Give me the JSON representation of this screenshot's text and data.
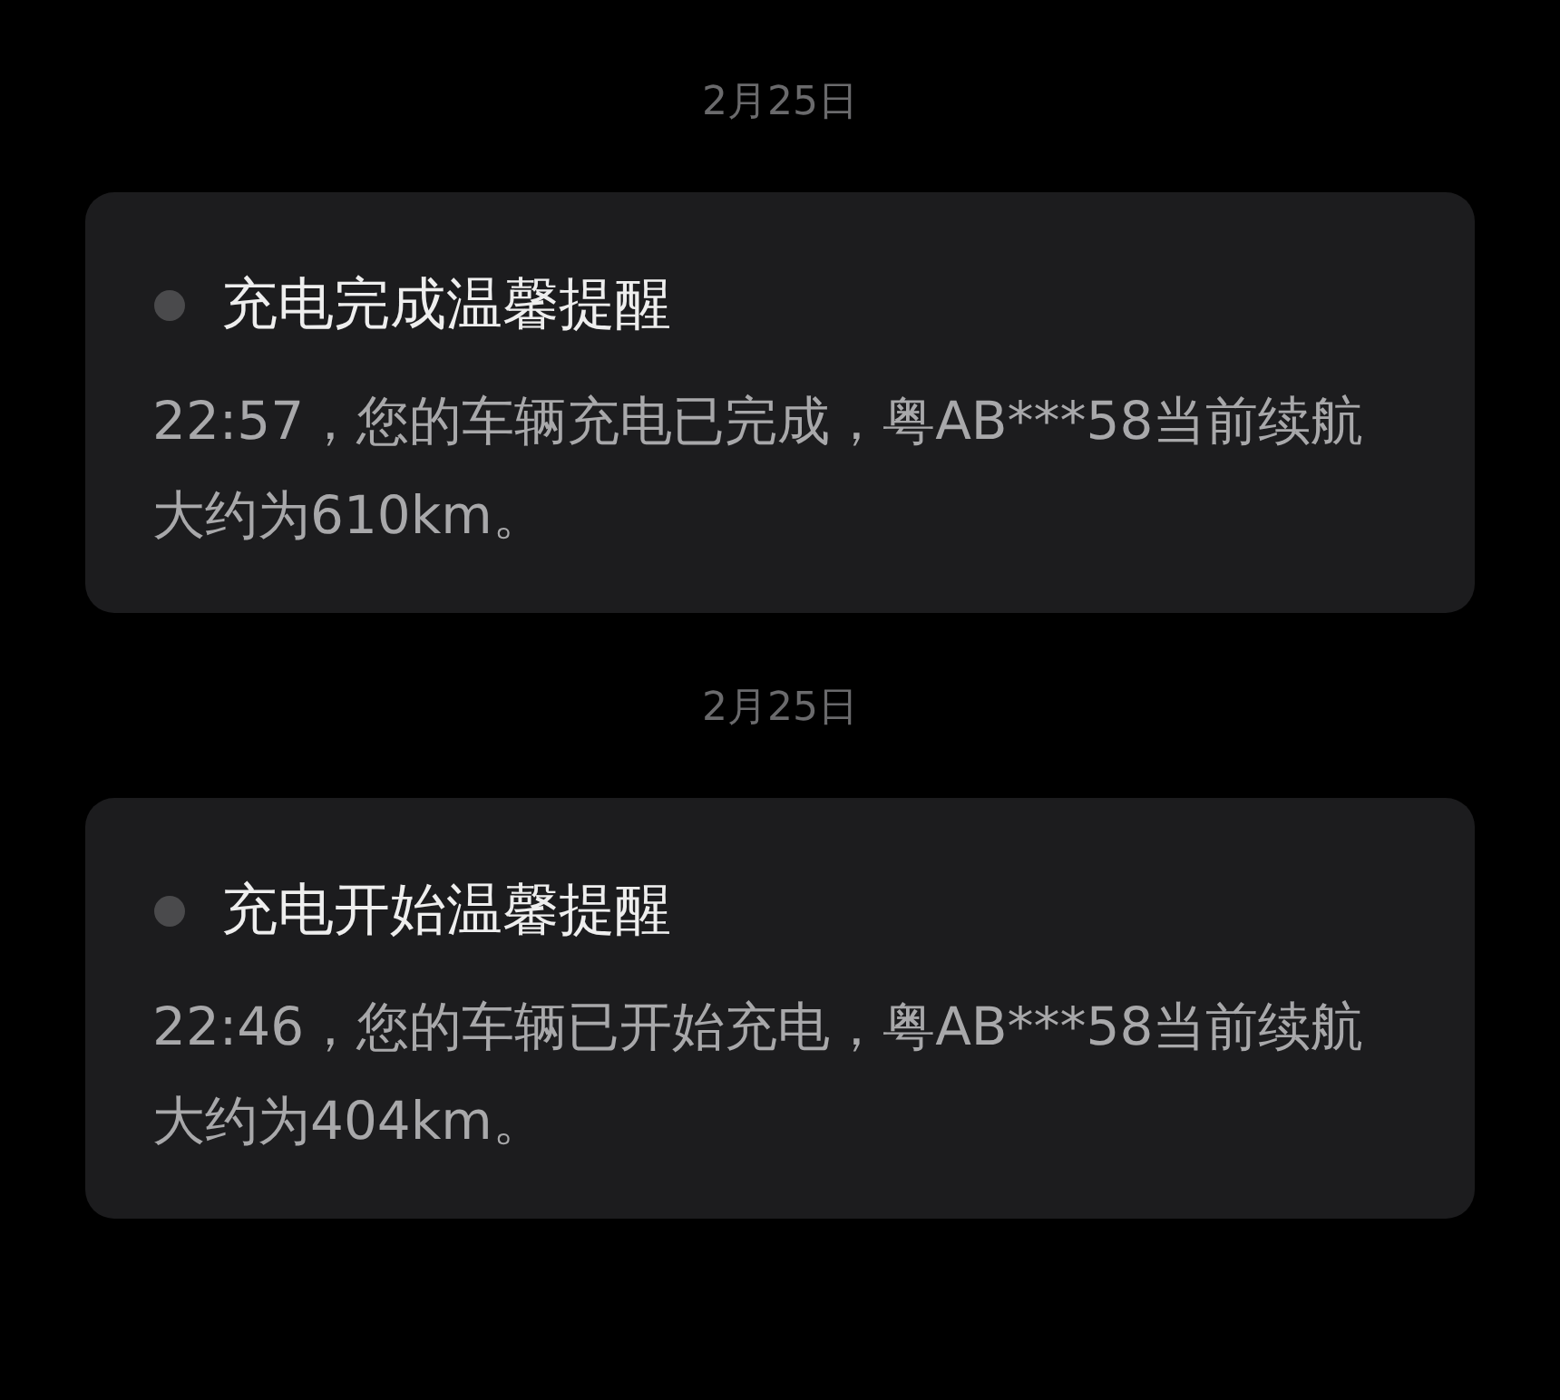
{
  "messages": [
    {
      "date": "2月25日",
      "title": "充电完成温馨提醒",
      "body": "22:57，您的车辆充电已完成，粤AB***58当前续航大约为610km。"
    },
    {
      "date": "2月25日",
      "title": "充电开始温馨提醒",
      "body": "22:46，您的车辆已开始充电，粤AB***58当前续航大约为404km。"
    }
  ]
}
